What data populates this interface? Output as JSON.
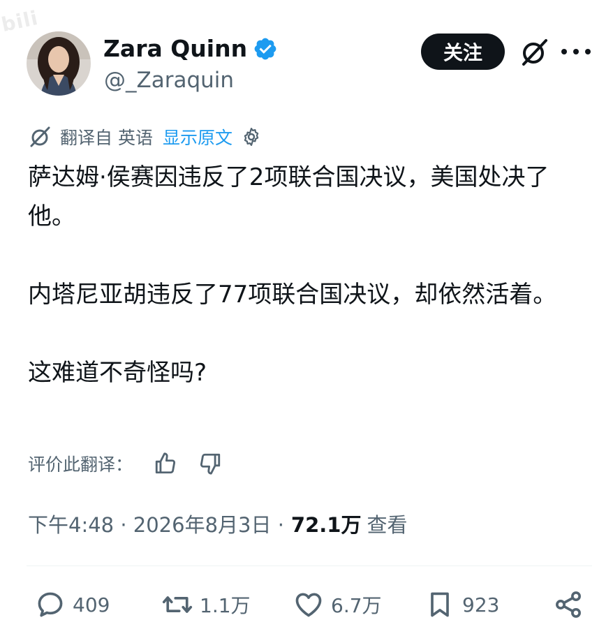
{
  "watermark": "bili",
  "author": {
    "display_name": "Zara Quinn",
    "handle": "@_Zaraquin"
  },
  "header": {
    "follow_label": "关注"
  },
  "translation": {
    "translated_from": "翻译自 英语",
    "show_original": "显示原文"
  },
  "tweet": {
    "paragraphs": [
      "萨达姆·侯赛因违反了2项联合国决议，美国处决了他。",
      "内塔尼亚胡违反了77项联合国决议，却依然活着。",
      "这难道不奇怪吗?"
    ]
  },
  "rate": {
    "label": "评价此翻译："
  },
  "meta": {
    "timestamp": "下午4:48 · 2026年8月3日 ·",
    "views_count": "72.1万",
    "views_label": "查看"
  },
  "actions": {
    "replies": "409",
    "reposts": "1.1万",
    "likes": "6.7万",
    "bookmarks": "923"
  },
  "colors": {
    "text": "#0f1419",
    "secondary": "#536471",
    "accent": "#1d9bf0",
    "button_bg": "#0f1419"
  },
  "icons": [
    "grok-icon",
    "more-icon",
    "verified-badge-icon",
    "translate-icon",
    "gear-icon",
    "thumbs-up-icon",
    "thumbs-down-icon",
    "reply-icon",
    "repost-icon",
    "like-icon",
    "bookmark-icon",
    "share-icon"
  ]
}
